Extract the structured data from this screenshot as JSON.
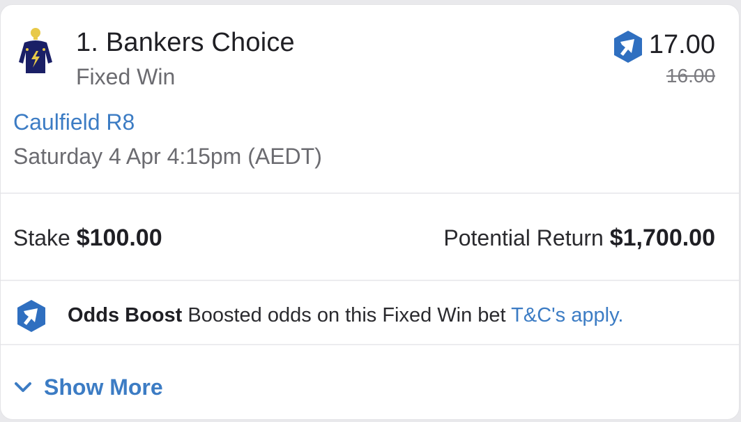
{
  "selection": {
    "runner": "1. Bankers Choice",
    "bet_type": "Fixed Win",
    "odds_boosted": "17.00",
    "odds_original": "16.00",
    "meeting": "Caulfield R8",
    "race_time": "Saturday 4 Apr 4:15pm (AEDT)"
  },
  "stake": {
    "label": "Stake",
    "value": "$100.00"
  },
  "potential_return": {
    "label": "Potential Return",
    "value": "$1,700.00"
  },
  "boost": {
    "title": "Odds Boost",
    "text": " Boosted odds on this Fixed Win bet ",
    "link": "T&C's apply."
  },
  "show_more": {
    "label": "Show More"
  },
  "icons": {
    "silks": "jockey-silks-icon",
    "boost": "odds-boost-icon",
    "chevron": "chevron-down-icon"
  },
  "colors": {
    "accent": "#3c7cc4",
    "boost_icon": "#2f6fc0",
    "silks_body": "#1a1f66",
    "silks_cap": "#e8c948"
  }
}
